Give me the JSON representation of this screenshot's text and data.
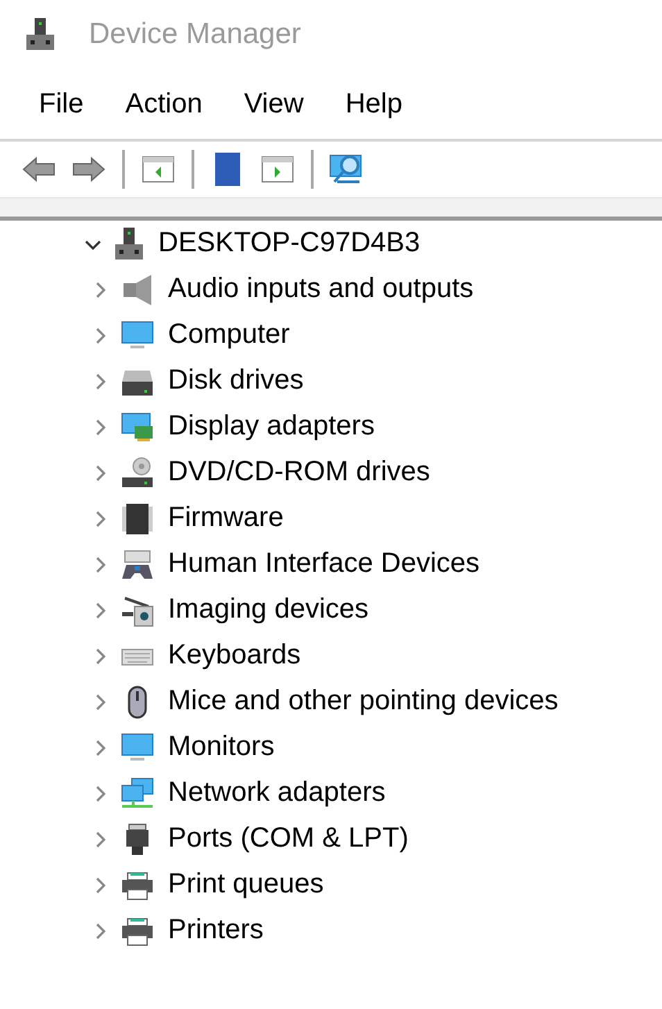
{
  "window": {
    "title": "Device Manager"
  },
  "menu": [
    "File",
    "Action",
    "View",
    "Help"
  ],
  "tree": {
    "label": "DESKTOP-C97D4B3",
    "expanded": true,
    "children": [
      {
        "label": "Audio inputs and outputs",
        "expanded": false
      },
      {
        "label": "Computer",
        "expanded": false
      },
      {
        "label": "Disk drives",
        "expanded": false
      },
      {
        "label": "Display adapters",
        "expanded": false
      },
      {
        "label": "DVD/CD-ROM drives",
        "expanded": false
      },
      {
        "label": "Firmware",
        "expanded": false
      },
      {
        "label": "Human Interface Devices",
        "expanded": false
      },
      {
        "label": "Imaging devices",
        "expanded": false
      },
      {
        "label": "Keyboards",
        "expanded": false
      },
      {
        "label": "Mice and other pointing devices",
        "expanded": false
      },
      {
        "label": "Monitors",
        "expanded": false
      },
      {
        "label": "Network adapters",
        "expanded": false
      },
      {
        "label": "Ports (COM & LPT)",
        "expanded": false
      },
      {
        "label": "Print queues",
        "expanded": false
      },
      {
        "label": "Printers",
        "expanded": false
      }
    ]
  }
}
